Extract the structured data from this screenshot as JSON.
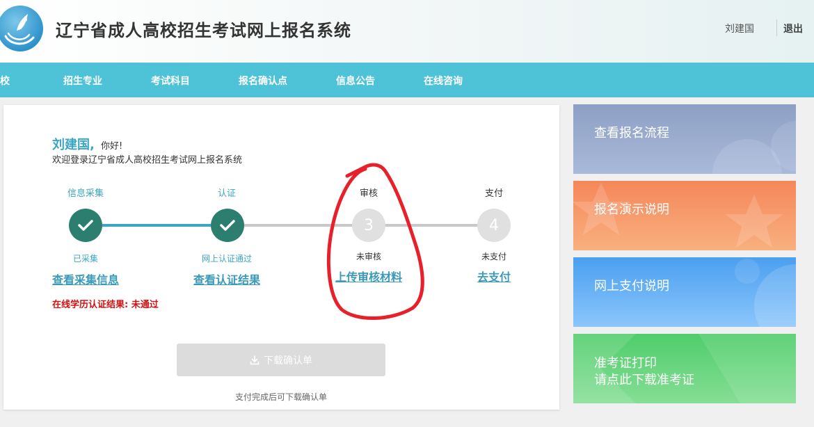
{
  "header": {
    "site_title": "辽宁省成人高校招生考试网上报名系统",
    "user_name": "刘建国",
    "logout_label": "退出"
  },
  "nav": {
    "items": [
      "院校",
      "招生专业",
      "考试科目",
      "报名确认点",
      "信息公告",
      "在线咨询"
    ]
  },
  "main": {
    "greeting_name": "刘建国,",
    "greeting_hello": "你好!",
    "welcome_text": "欢迎登录辽宁省成人高校招生考试网上报名系统",
    "steps": [
      {
        "title": "信息采集",
        "number": "",
        "status": "已采集",
        "link": "查看采集信息",
        "state": "done"
      },
      {
        "title": "认证",
        "number": "",
        "status": "网上认证通过",
        "link": "查看认证结果",
        "state": "done"
      },
      {
        "title": "审核",
        "number": "3",
        "status": "未审核",
        "link": "上传审核材料",
        "state": "todo"
      },
      {
        "title": "支付",
        "number": "4",
        "status": "未支付",
        "link": "去支付",
        "state": "todo"
      }
    ],
    "verify_result": "在线学历认证结果: 未通过",
    "download_button": "下载确认单",
    "download_note": "支付完成后可下载确认单"
  },
  "side_panels": [
    {
      "lines": [
        "查看报名流程"
      ]
    },
    {
      "lines": [
        "报名演示说明"
      ]
    },
    {
      "lines": [
        "网上支付说明"
      ]
    },
    {
      "lines": [
        "准考证打印",
        "请点此下载准考证"
      ]
    }
  ],
  "colors": {
    "nav_bg": "#4ec3d8",
    "accent": "#3aa6c2",
    "done_circle": "#2c7f6f",
    "error_text": "#d51010",
    "annotation": "#e8202a"
  }
}
